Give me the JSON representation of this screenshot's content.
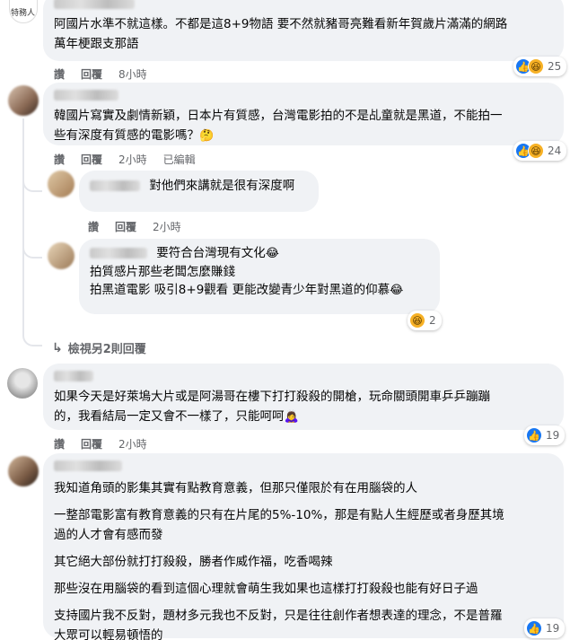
{
  "comment1": {
    "avatar_text": "特務人",
    "text_line1": "阿國片水準不就這樣。不都是這8+9物語 要不然就豬哥亮難看新年賀歲片滿滿的網路",
    "text_line2": "萬年梗跟支那語",
    "actions": {
      "like": "讚",
      "reply": "回覆",
      "time": "8小時"
    },
    "reaction_count": "25"
  },
  "comment2": {
    "text_line1": "韓國片寫實及劇情新穎，日本片有質感，台灣電影拍的不是乩童就是黑道，不能拍一",
    "text_line2": "些有深度有質感的電影嗎？",
    "emoji": "🤔",
    "actions": {
      "like": "讚",
      "reply": "回覆",
      "time": "2小時",
      "edited": "已編輯"
    },
    "reaction_count": "24"
  },
  "reply1": {
    "text": "對他們來講就是很有深度啊",
    "actions": {
      "like": "讚",
      "reply": "回覆",
      "time": "2小時"
    }
  },
  "reply2": {
    "line1": "要符合台灣現有文化",
    "line2": "拍質感片那些老闆怎麼賺錢",
    "line3": "拍黑道電影 吸引8+9觀看 更能改變青少年對黑道的仰慕",
    "emoji": "😂",
    "actions": {
      "like": "讚",
      "reply": "回覆",
      "time": "2小時"
    },
    "reaction_count": "2"
  },
  "view_more": {
    "label": "檢視另2則回覆"
  },
  "comment3": {
    "text_line1": "如果今天是好萊塢大片或是阿湯哥在樓下打打殺殺的開槍，玩命關頭開車乒乒蹦蹦",
    "text_line2": "的，我看結局一定又會不一樣了，只能呵呵",
    "emoji": "🙇‍♀️",
    "actions": {
      "like": "讚",
      "reply": "回覆",
      "time": "2小時"
    },
    "reaction_count": "19"
  },
  "comment4": {
    "paragraphs": [
      "我知道角頭的影集其實有點教育意義，但那只僅限於有在用腦袋的人",
      "一整部電影富有教育意義的只有在片尾的5%-10%，那是有點人生經歷或者身歷其境",
      "過的人才會有感而發",
      "其它絕大部份就打打殺殺，勝者作威作福，吃香喝辣",
      "那些沒在用腦袋的看到這個心理就會萌生我如果也這樣打打殺殺也能有好日子過",
      "支持國片我不反對，題材多元我也不反對，只是往往創作者想表達的理念，不是普羅",
      "大眾可以輕易頓悟的"
    ],
    "reaction_count": "19"
  },
  "colors": {
    "bubble": "#f0f2f5",
    "meta": "#65676b",
    "like_blue": "#1877f2",
    "haha_yellow": "#f7b125"
  }
}
